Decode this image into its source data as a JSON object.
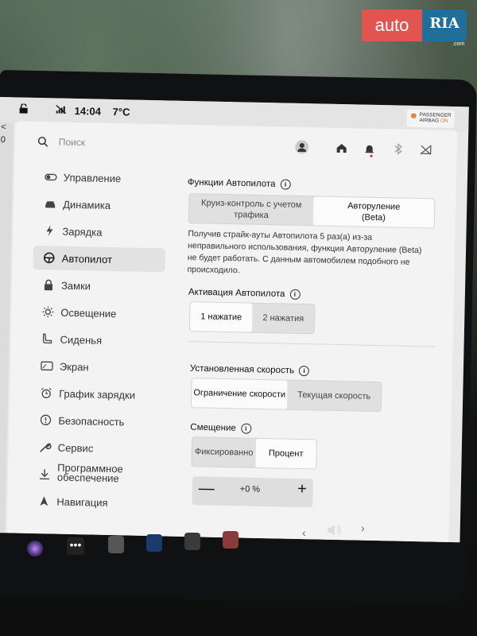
{
  "status_bar": {
    "time": "14:04",
    "temperature": "7°C",
    "passenger_airbag": [
      "PASSENGER",
      "AIRBAG",
      "ON"
    ],
    "left_edge_chars": [
      "<",
      "0"
    ]
  },
  "header": {
    "search_placeholder": "Поиск",
    "icons": [
      "user-icon",
      "home-icon",
      "bell-icon",
      "bluetooth-icon",
      "no-signal-icon"
    ],
    "notification_color": "#d22222"
  },
  "sidebar": {
    "items": [
      {
        "label": "Управление",
        "icon": "toggle-icon",
        "active": false
      },
      {
        "label": "Динамика",
        "icon": "car-icon",
        "active": false
      },
      {
        "label": "Зарядка",
        "icon": "bolt-icon",
        "active": false
      },
      {
        "label": "Автопилот",
        "icon": "steering-wheel-icon",
        "active": true
      },
      {
        "label": "Замки",
        "icon": "lock-icon",
        "active": false
      },
      {
        "label": "Освещение",
        "icon": "sun-icon",
        "active": false
      },
      {
        "label": "Сиденья",
        "icon": "seat-icon",
        "active": false
      },
      {
        "label": "Экран",
        "icon": "screen-icon",
        "active": false
      },
      {
        "label": "График зарядки",
        "icon": "alarm-icon",
        "active": false
      },
      {
        "label": "Безопасность",
        "icon": "info-circle-icon",
        "active": false
      },
      {
        "label": "Сервис",
        "icon": "wrench-icon",
        "active": false
      },
      {
        "label": [
          "Программное",
          "обеспечение"
        ],
        "icon": "download-icon",
        "active": false
      },
      {
        "label": "Навигация",
        "icon": "navigation-icon",
        "active": false
      }
    ]
  },
  "autopilot": {
    "features_title": "Функции Автопилота",
    "features_options": [
      [
        "Круиз-контроль с учетом",
        "трафика"
      ],
      [
        "Авторуление",
        "(Beta)"
      ]
    ],
    "features_selected": 1,
    "strike_note": [
      "Получив страйк-ауты Автопилота 5 раз(а) из-за",
      "неправильного использования, функция Авторуление (Beta)",
      "не будет работать. С данным автомобилем подобного не",
      "происходило."
    ],
    "activation_title": "Активация Автопилота",
    "activation_options": [
      "1 нажатие",
      "2 нажатия"
    ],
    "activation_selected": 0,
    "speed_title": "Установленная скорость",
    "speed_options": [
      "Ограничение скорости",
      "Текущая скорость"
    ],
    "speed_selected": 0,
    "offset_title": "Смещение",
    "offset_options": [
      "Фиксированно",
      "Процент"
    ],
    "offset_selected": 1,
    "offset_value": "+0 %",
    "minus": "—",
    "plus": "+"
  },
  "watermark": {
    "left": "auto",
    "right": "RIA",
    "domain": ".com"
  }
}
